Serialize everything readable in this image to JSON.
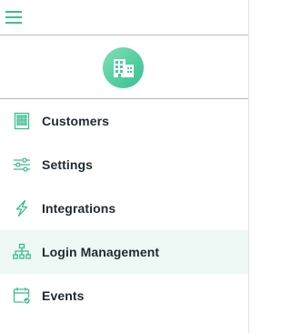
{
  "menu": {
    "icon": "hamburger-menu-icon"
  },
  "brand": {
    "icon": "building-icon",
    "accent": "#3dbd8f"
  },
  "nav": {
    "active_index": 3,
    "items": [
      {
        "label": "Customers",
        "icon": "building-grid-icon"
      },
      {
        "label": "Settings",
        "icon": "sliders-icon"
      },
      {
        "label": "Integrations",
        "icon": "lightning-icon"
      },
      {
        "label": "Login Management",
        "icon": "sitemap-icon"
      },
      {
        "label": "Events",
        "icon": "calendar-check-icon"
      }
    ]
  },
  "colors": {
    "accent": "#3dbd8f",
    "active_background": "#eef8f4",
    "text": "#1f2a30",
    "divider": "#b9b9b9"
  }
}
